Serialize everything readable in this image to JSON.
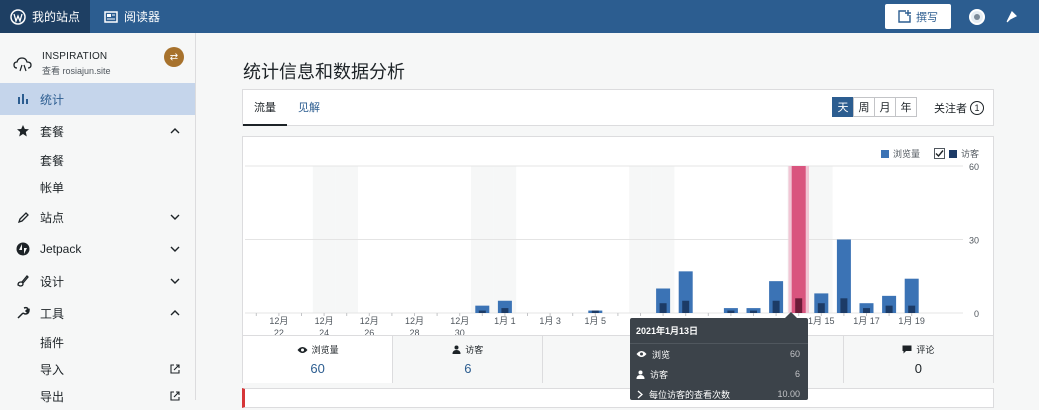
{
  "topbar": {
    "my_sites": "我的站点",
    "reader": "阅读器",
    "write": "撰写"
  },
  "site": {
    "name": "INSPIRATION",
    "url": "查看 rosiajun.site"
  },
  "sidebar": {
    "items": [
      {
        "label": "统计",
        "icon": "bar-chart-icon"
      },
      {
        "label": "套餐",
        "icon": "star-icon"
      },
      {
        "label": "套餐"
      },
      {
        "label": "帐单"
      },
      {
        "label": "站点",
        "icon": "pencil-icon"
      },
      {
        "label": "Jetpack",
        "icon": "jetpack-icon"
      },
      {
        "label": "设计",
        "icon": "brush-icon"
      },
      {
        "label": "工具",
        "icon": "wrench-icon"
      },
      {
        "label": "插件"
      },
      {
        "label": "导入"
      },
      {
        "label": "导出"
      }
    ]
  },
  "page": {
    "title": "统计信息和数据分析"
  },
  "tabs": {
    "traffic": "流量",
    "insights": "见解"
  },
  "period": [
    "天",
    "周",
    "月",
    "年"
  ],
  "followers": {
    "label": "关注者",
    "count": "1"
  },
  "colors": {
    "views": "#3b73b5",
    "visitors": "#1c3b66",
    "highlight": "#d9547e",
    "brand": "#2c5d90"
  },
  "chart_data": {
    "type": "bar",
    "categories": [
      "12月 21",
      "12月 22",
      "12月 23",
      "12月 24",
      "12月 25",
      "12月 26",
      "12月 27",
      "12月 28",
      "12月 29",
      "12月 30",
      "12月 31",
      "1月 1",
      "1月 2",
      "1月 3",
      "1月 4",
      "1月 5",
      "1月 6",
      "1月 7",
      "1月 8",
      "1月 9",
      "1月 10",
      "1月 11",
      "1月 12",
      "1月 13",
      "1月 14",
      "1月 15",
      "1月 16",
      "1月 17",
      "1月 18",
      "1月 19"
    ],
    "tick_labels": [
      {
        "line1": "12月",
        "line2": "22",
        "index": 1
      },
      {
        "line1": "12月",
        "line2": "24",
        "index": 3
      },
      {
        "line1": "12月",
        "line2": "26",
        "index": 5
      },
      {
        "line1": "12月",
        "line2": "28",
        "index": 7
      },
      {
        "line1": "12月",
        "line2": "30",
        "index": 9
      },
      {
        "line1": "1月 1",
        "line2": "",
        "index": 11
      },
      {
        "line1": "1月 3",
        "line2": "",
        "index": 13
      },
      {
        "line1": "1月 5",
        "line2": "",
        "index": 15
      },
      {
        "line1": "1月 15",
        "line2": "",
        "index": 25
      },
      {
        "line1": "1月 17",
        "line2": "",
        "index": 27
      },
      {
        "line1": "1月 19",
        "line2": "",
        "index": 29
      }
    ],
    "weekend_indices": [
      3,
      4,
      10,
      11,
      17,
      18,
      24,
      25
    ],
    "series": [
      {
        "name": "浏览量",
        "values": [
          0,
          0,
          0,
          0,
          0,
          0,
          0,
          0,
          0,
          0,
          3,
          5,
          0,
          0,
          0,
          1,
          0,
          0,
          10,
          17,
          0,
          2,
          2,
          13,
          60,
          8,
          30,
          4,
          7,
          14
        ]
      },
      {
        "name": "访客",
        "values": [
          0,
          0,
          0,
          0,
          0,
          0,
          0,
          0,
          0,
          0,
          1,
          2,
          0,
          0,
          0,
          1,
          0,
          0,
          4,
          5,
          0,
          1,
          1,
          5,
          6,
          4,
          6,
          2,
          3,
          3
        ]
      }
    ],
    "highlight_index": 24,
    "y_ticks": [
      "60",
      "30",
      "0"
    ],
    "ylim": [
      0,
      60
    ]
  },
  "summary": [
    {
      "label": "浏览量",
      "value": "60",
      "icon": "eye-icon"
    },
    {
      "label": "访客",
      "value": "6",
      "icon": "user-icon"
    },
    {
      "label": "",
      "value": "",
      "icon": ""
    },
    {
      "label": "",
      "value": "",
      "icon": ""
    },
    {
      "label": "评论",
      "value": "0",
      "icon": "comment-icon"
    }
  ],
  "tooltip": {
    "date": "2021年1月13日",
    "rows": [
      {
        "label": "浏览",
        "value": "60",
        "icon": "eye-icon"
      },
      {
        "label": "访客",
        "value": "6",
        "icon": "user-icon"
      },
      {
        "label": "每位访客的查看次数",
        "value": "10.00",
        "icon": "chevron-right-icon"
      }
    ]
  },
  "legend": {
    "views": "浏览量",
    "visitors": "访客"
  }
}
